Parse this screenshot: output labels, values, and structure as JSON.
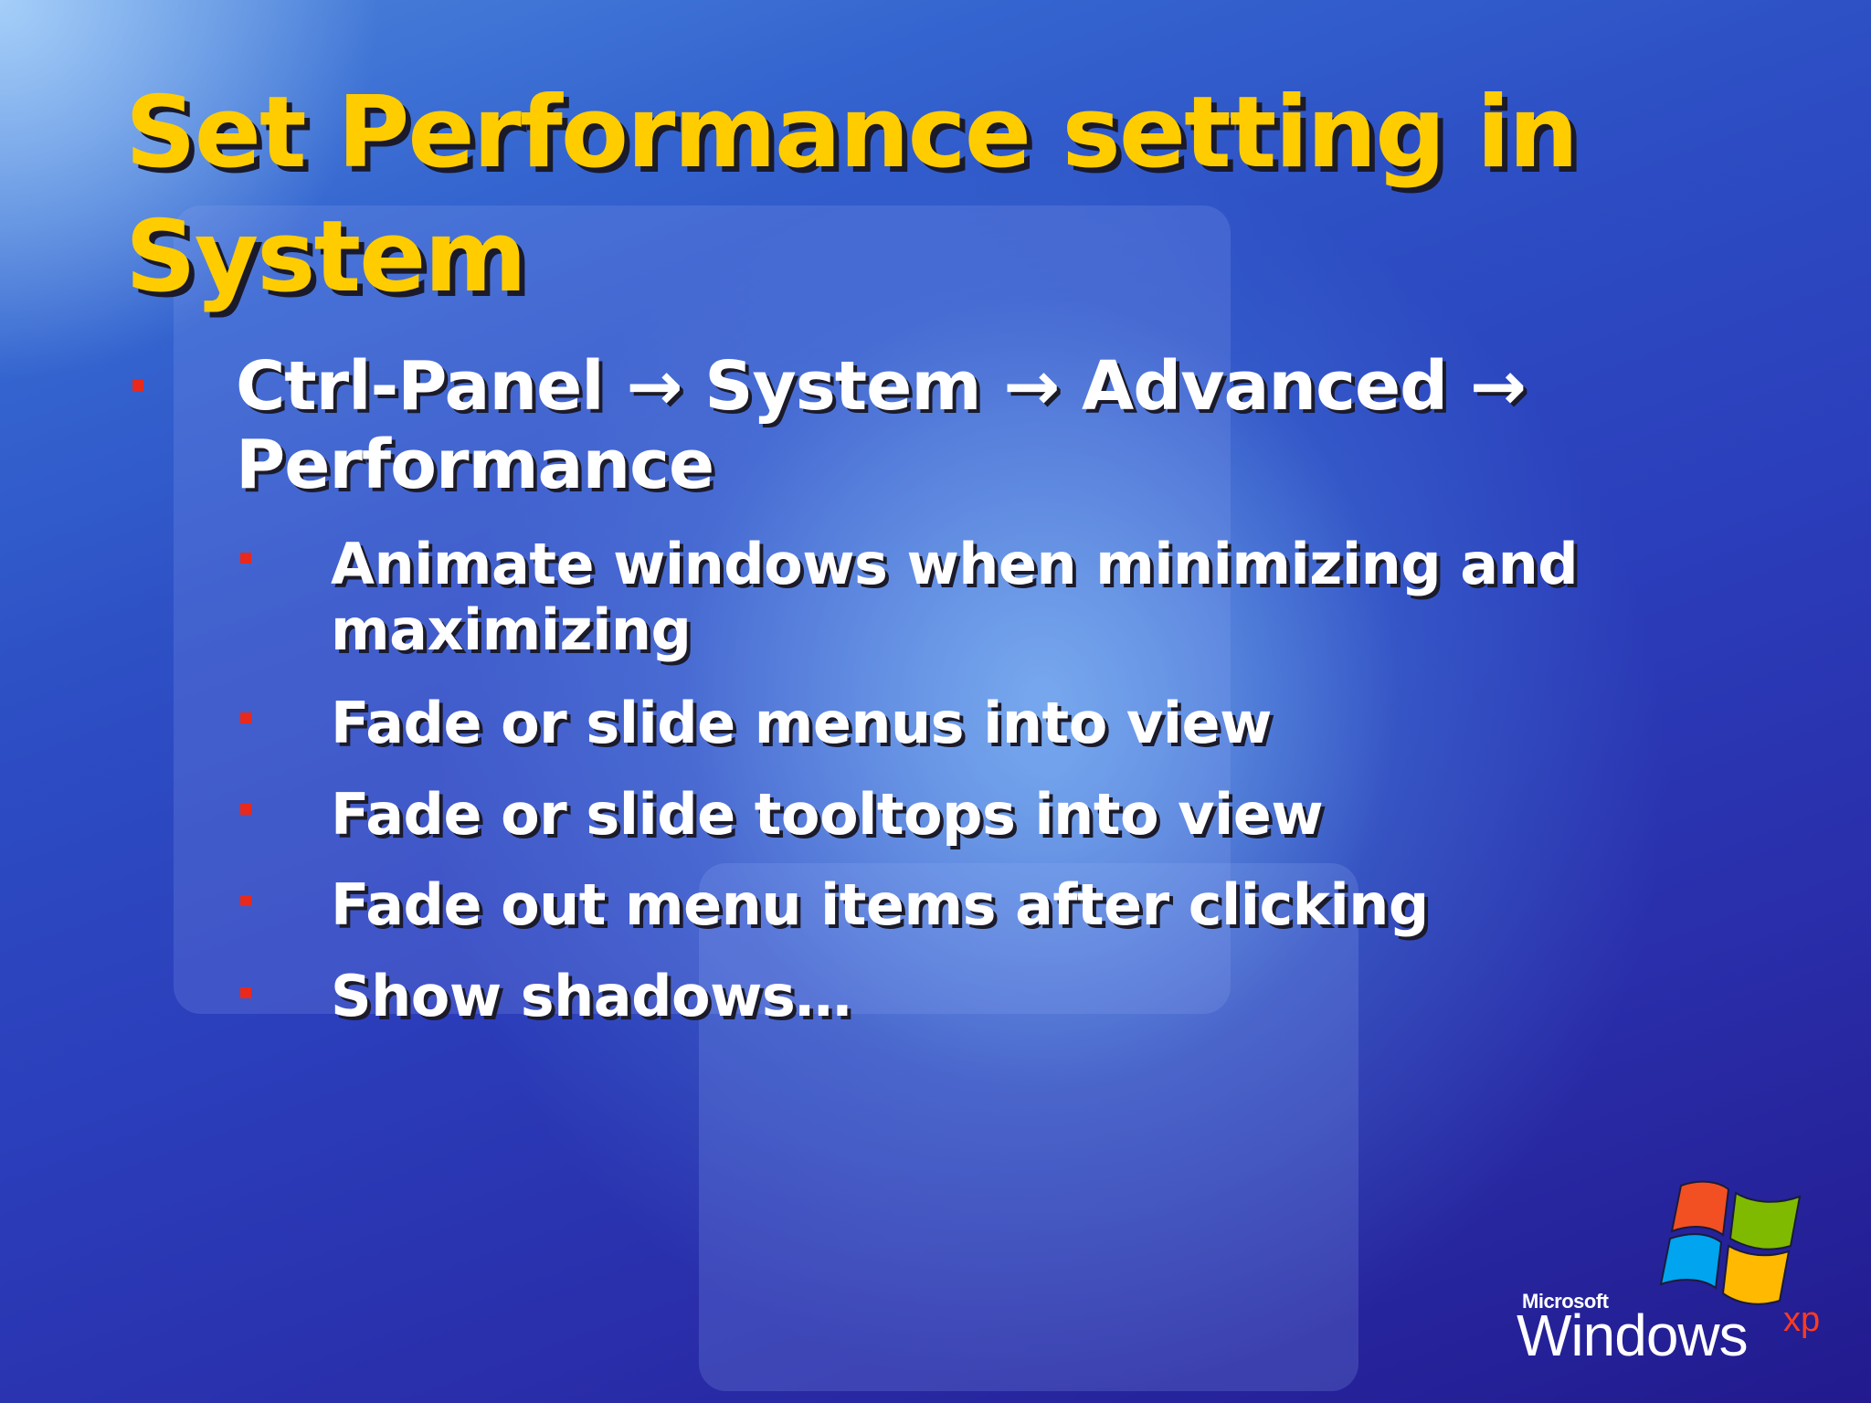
{
  "slide": {
    "title": "Set Performance setting in System",
    "main_bullet": "Ctrl-Panel → System → Advanced → Performance",
    "sub_bullets": [
      "Animate windows when minimizing and maximizing",
      "Fade or slide menus into view",
      "Fade or slide tooltops into view",
      "Fade out menu items after clicking",
      "Show shadows…"
    ]
  },
  "logo": {
    "brand": "Microsoft",
    "product": "Windows",
    "edition": "xp",
    "icon": "windows-flag-icon"
  },
  "colors": {
    "title": "#ffcc00",
    "body_text": "#ffffff",
    "bullet": "#e8291b",
    "background_top": "#4d86dc",
    "background_bottom": "#221a8e"
  }
}
